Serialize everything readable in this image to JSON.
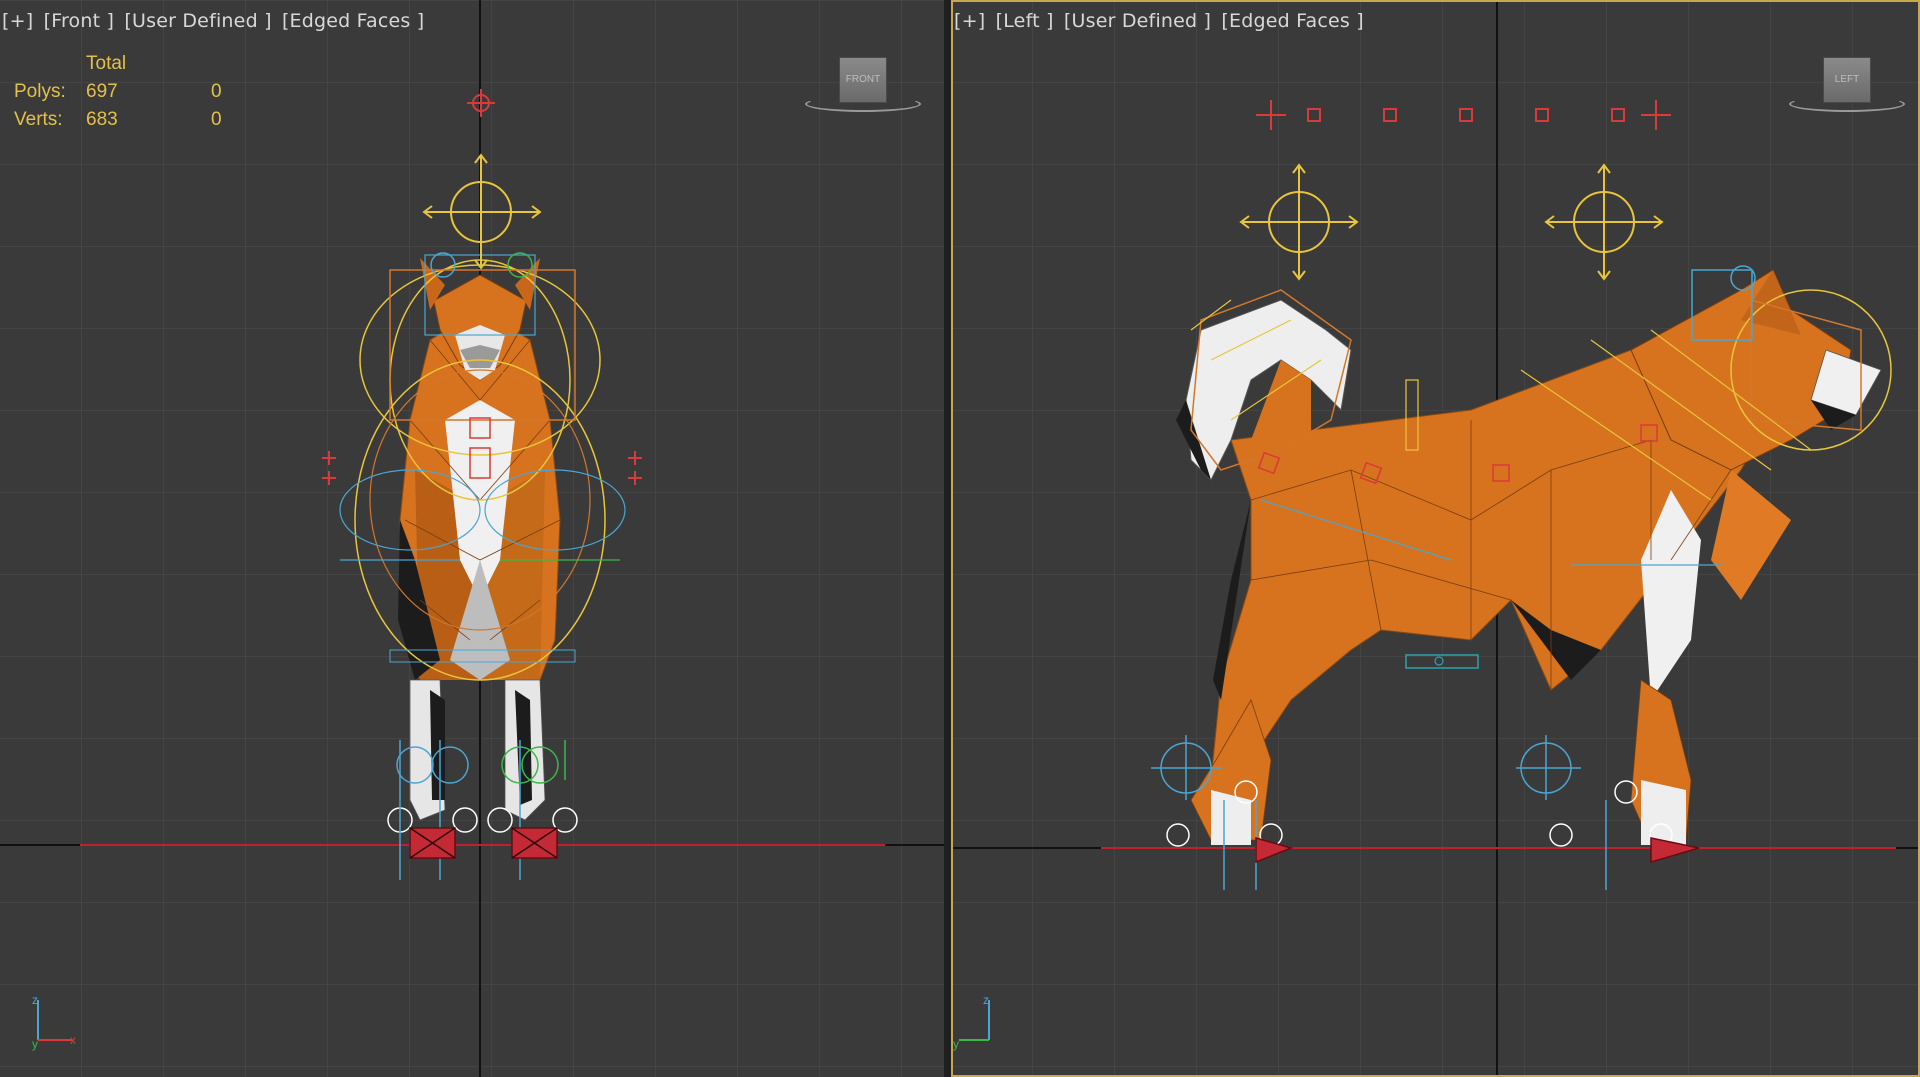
{
  "viewports": {
    "front": {
      "label_parts": [
        "[+]",
        "[Front ]",
        "[User Defined ]",
        "[Edged Faces ]"
      ],
      "viewcube_label": "FRONT",
      "stats": {
        "header": "Total",
        "polys_label": "Polys:",
        "polys_total": "697",
        "polys_sel": "0",
        "verts_label": "Verts:",
        "verts_total": "683",
        "verts_sel": "0"
      }
    },
    "left": {
      "label_parts": [
        "[+]",
        "[Left ]",
        "[User Defined ]",
        "[Edged Faces ]"
      ],
      "viewcube_label": "LEFT"
    }
  },
  "colors": {
    "viewport_bg": "#3a3a3a",
    "grid": "#4a4a4a",
    "axis": "#111111",
    "ground_line": "#c0202a",
    "model_orange": "#d7721f",
    "model_white": "#eeeeee",
    "bone_yellow": "#e8c53a",
    "bone_orange": "#d2772a",
    "ik_red": "#d93a3a",
    "helper_blue": "#4aa6d2",
    "active_border": "#c8a84a",
    "stats_text": "#e4c04a"
  },
  "axis_tripod": {
    "z": "z",
    "y": "y",
    "x": "x"
  }
}
